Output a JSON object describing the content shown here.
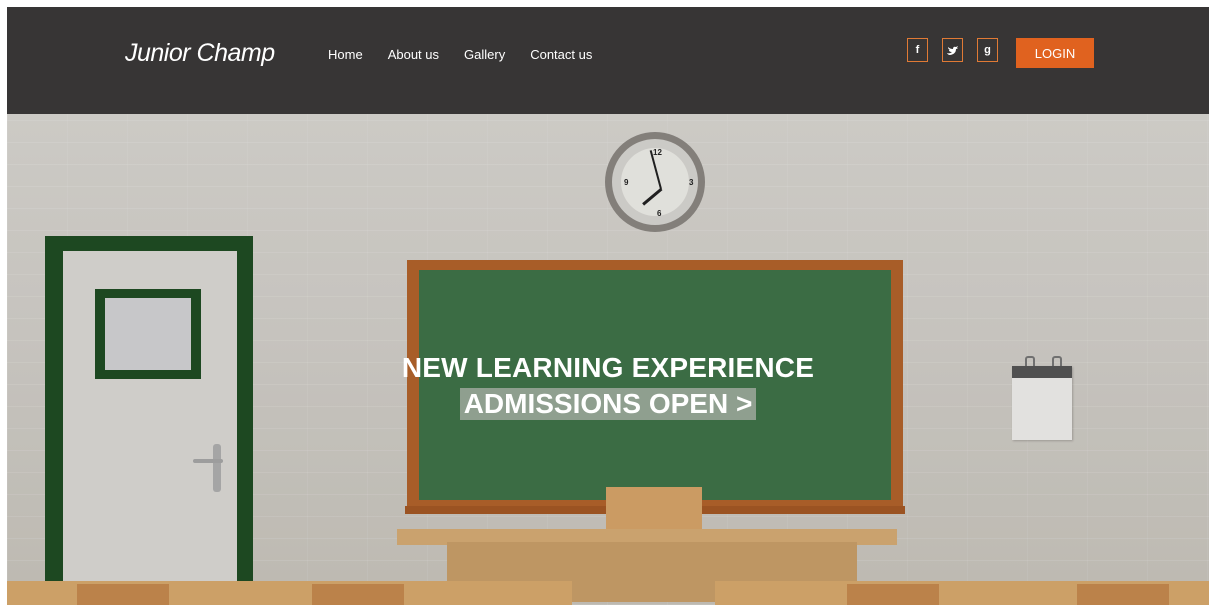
{
  "header": {
    "brand": "Junior Champ",
    "nav": [
      "Home",
      "About us",
      "Gallery",
      "Contact us"
    ],
    "social": [
      {
        "icon": "facebook-icon",
        "glyph": "f"
      },
      {
        "icon": "twitter-icon",
        "glyph": "🐦"
      },
      {
        "icon": "google-plus-icon",
        "glyph": "g"
      }
    ],
    "login_label": "LOGIN"
  },
  "hero": {
    "headline": "NEW LEARNING EXPERIENCE",
    "cta": "ADMISSIONS OPEN >",
    "clock_numbers": [
      "12",
      "3",
      "6",
      "9"
    ]
  },
  "colors": {
    "header_bg": "#373535",
    "accent": "#e0621f",
    "board": "#3f7349"
  }
}
